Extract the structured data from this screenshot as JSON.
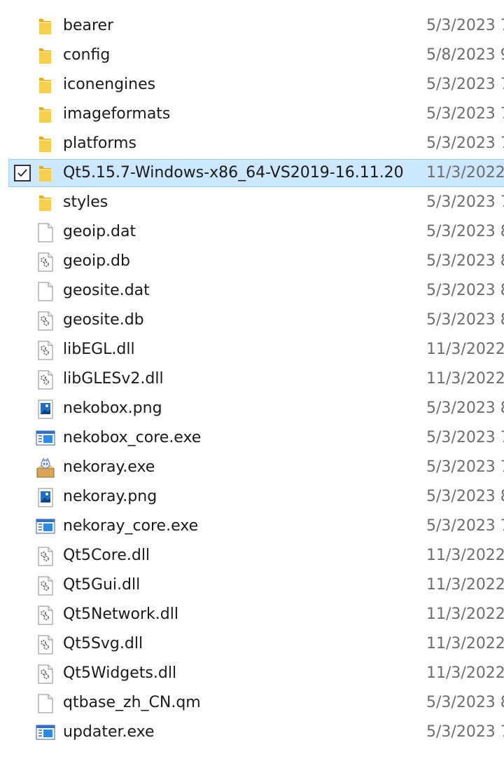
{
  "files": [
    {
      "name": "bearer",
      "date": "5/3/2023 7",
      "icon": "folder-icon"
    },
    {
      "name": "config",
      "date": "5/8/2023 9",
      "icon": "folder-icon"
    },
    {
      "name": "iconengines",
      "date": "5/3/2023 7",
      "icon": "folder-icon"
    },
    {
      "name": "imageformats",
      "date": "5/3/2023 7",
      "icon": "folder-icon"
    },
    {
      "name": "platforms",
      "date": "5/3/2023 7",
      "icon": "folder-icon"
    },
    {
      "name": "Qt5.15.7-Windows-x86_64-VS2019-16.11.20",
      "date": "11/3/2022",
      "icon": "folder-icon",
      "selected": true,
      "checked": true
    },
    {
      "name": "styles",
      "date": "5/3/2023 7",
      "icon": "folder-icon"
    },
    {
      "name": "geoip.dat",
      "date": "5/3/2023 8",
      "icon": "blank-file-icon"
    },
    {
      "name": "geoip.db",
      "date": "5/3/2023 8",
      "icon": "settings-file-icon"
    },
    {
      "name": "geosite.dat",
      "date": "5/3/2023 8",
      "icon": "blank-file-icon"
    },
    {
      "name": "geosite.db",
      "date": "5/3/2023 8",
      "icon": "settings-file-icon"
    },
    {
      "name": "libEGL.dll",
      "date": "11/3/2022",
      "icon": "settings-file-icon"
    },
    {
      "name": "libGLESv2.dll",
      "date": "11/3/2022",
      "icon": "settings-file-icon"
    },
    {
      "name": "nekobox.png",
      "date": "5/3/2023 8",
      "icon": "image-file-icon"
    },
    {
      "name": "nekobox_core.exe",
      "date": "5/3/2023 7",
      "icon": "exe-window-icon"
    },
    {
      "name": "nekoray.exe",
      "date": "5/3/2023 7",
      "icon": "nekoray-app-icon"
    },
    {
      "name": "nekoray.png",
      "date": "5/3/2023 8",
      "icon": "image-file-icon"
    },
    {
      "name": "nekoray_core.exe",
      "date": "5/3/2023 7",
      "icon": "exe-window-icon"
    },
    {
      "name": "Qt5Core.dll",
      "date": "11/3/2022",
      "icon": "settings-file-icon"
    },
    {
      "name": "Qt5Gui.dll",
      "date": "11/3/2022",
      "icon": "settings-file-icon"
    },
    {
      "name": "Qt5Network.dll",
      "date": "11/3/2022",
      "icon": "settings-file-icon"
    },
    {
      "name": "Qt5Svg.dll",
      "date": "11/3/2022",
      "icon": "settings-file-icon"
    },
    {
      "name": "Qt5Widgets.dll",
      "date": "11/3/2022",
      "icon": "settings-file-icon"
    },
    {
      "name": "qtbase_zh_CN.qm",
      "date": "5/3/2023 8",
      "icon": "blank-file-icon"
    },
    {
      "name": "updater.exe",
      "date": "5/3/2023 7",
      "icon": "exe-window-icon"
    }
  ],
  "colors": {
    "selection_bg": "#cce8ff",
    "selection_border": "#99d1ff",
    "folder": "#f5c342",
    "date_text": "#6d6d6d"
  }
}
